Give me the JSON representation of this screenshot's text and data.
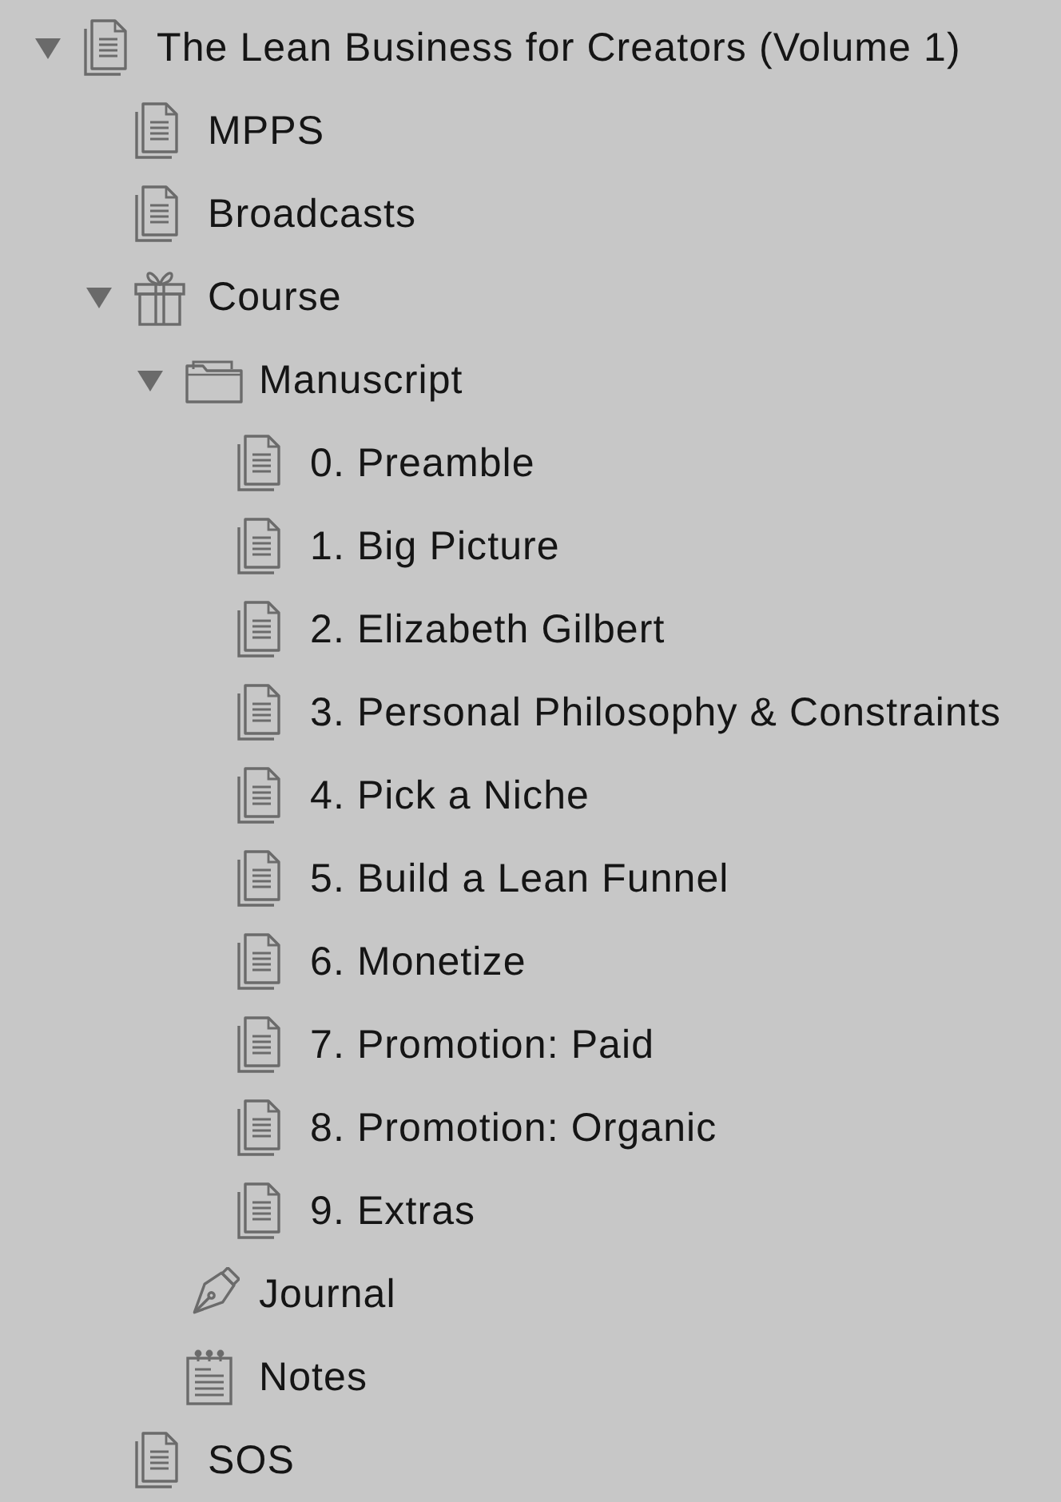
{
  "outline": [
    {
      "label": "The Lean Business for Creators (Volume 1)",
      "kind": "document",
      "expanded": true,
      "children": [
        {
          "label": "MPPS",
          "kind": "document"
        },
        {
          "label": "Broadcasts",
          "kind": "document"
        },
        {
          "label": "Course",
          "kind": "gift",
          "expanded": true,
          "children": [
            {
              "label": "Manuscript",
              "kind": "folder",
              "expanded": true,
              "children": [
                {
                  "label": "0. Preamble",
                  "kind": "document"
                },
                {
                  "label": "1. Big Picture",
                  "kind": "document"
                },
                {
                  "label": "2. Elizabeth Gilbert",
                  "kind": "document"
                },
                {
                  "label": "3. Personal Philosophy & Constraints",
                  "kind": "document"
                },
                {
                  "label": "4. Pick a Niche",
                  "kind": "document"
                },
                {
                  "label": "5. Build a Lean Funnel",
                  "kind": "document"
                },
                {
                  "label": "6. Monetize",
                  "kind": "document"
                },
                {
                  "label": "7. Promotion: Paid",
                  "kind": "document"
                },
                {
                  "label": "8. Promotion: Organic",
                  "kind": "document"
                },
                {
                  "label": "9. Extras",
                  "kind": "document"
                }
              ]
            },
            {
              "label": "Journal",
              "kind": "pen"
            },
            {
              "label": "Notes",
              "kind": "notes"
            }
          ]
        },
        {
          "label": "SOS",
          "kind": "document"
        }
      ]
    }
  ]
}
